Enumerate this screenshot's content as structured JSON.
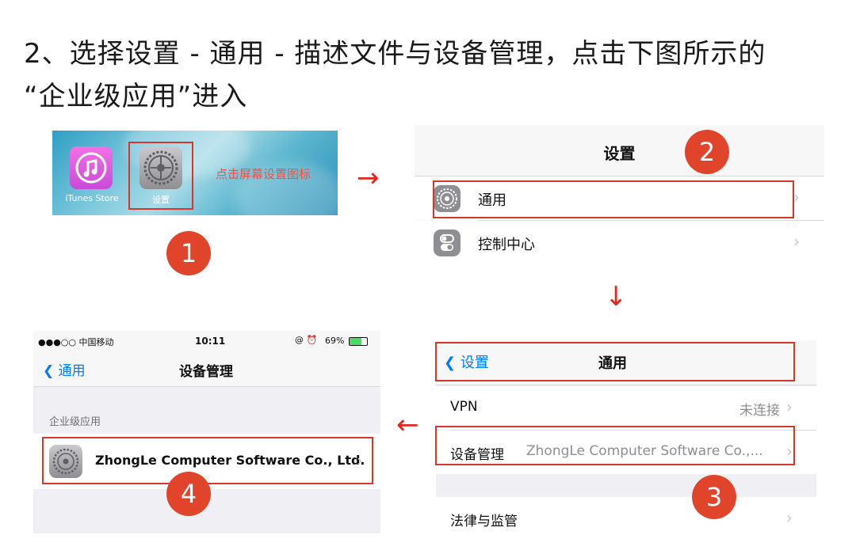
{
  "heading": {
    "line1": "2、选择设置 - 通用 - 描述文件与设备管理，点击下图所示的",
    "line2": "“企业级应用”进入"
  },
  "badges": [
    "1",
    "2",
    "3",
    "4"
  ],
  "arrows": {
    "right": "→",
    "down": "↓",
    "left": "←"
  },
  "step1": {
    "apps": [
      {
        "label": "iTunes Store",
        "icon": "itunes-store-icon"
      },
      {
        "label": "设置",
        "icon": "settings-gear-icon"
      }
    ],
    "hint": "点击屏幕设置图标",
    "hint_color": "#ff3b30"
  },
  "step2": {
    "nav_title": "设置",
    "rows": [
      {
        "label": "通用",
        "icon": "settings-gear-icon"
      },
      {
        "label": "控制中心",
        "icon": "control-center-icon"
      }
    ],
    "chevron": "›"
  },
  "step3": {
    "status": {
      "carrier": "●●●○○ 中国移动",
      "time": "10:11",
      "battery": "69%",
      "icons": "@ ⏰"
    },
    "nav_back": "通用",
    "nav_title": "设备管理",
    "section_header": "企业级应用",
    "profile_name": "ZhongLe Computer Software Co., Ltd.",
    "chevron": "›"
  },
  "step4": {
    "nav_back": "设置",
    "nav_title": "通用",
    "rows": [
      {
        "label": "VPN",
        "value": "未连接"
      },
      {
        "label": "设备管理",
        "value": "ZhongLe Computer Software Co.,..."
      },
      {
        "label": "法律与监管",
        "value": ""
      }
    ],
    "chevron": "›",
    "accent": "#007aff"
  }
}
